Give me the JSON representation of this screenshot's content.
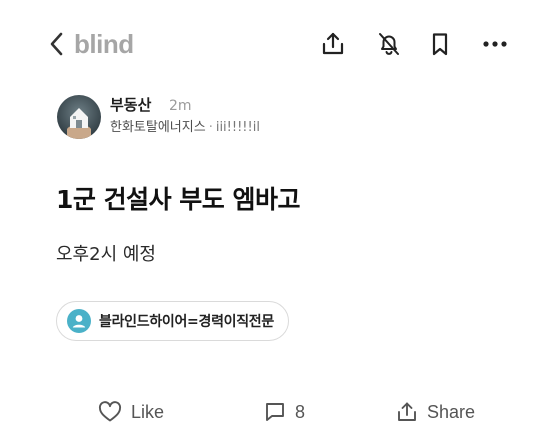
{
  "header": {
    "brand": "blind",
    "icons": [
      "chevron-left-icon",
      "share-icon",
      "bell-off-icon",
      "bookmark-icon",
      "more-icon"
    ]
  },
  "author": {
    "name": "부동산",
    "time": "2m",
    "company": "한화토탈에너지스",
    "separator": "·",
    "handle": "iii!!!!!il"
  },
  "post": {
    "title": "1군 건설사 부도 엠바고",
    "body": "오후2시 예정"
  },
  "channel": {
    "label": "블라인드하이어=경력이직전문",
    "icon": "person-icon",
    "icon_color": "#4ab1c8"
  },
  "footer": {
    "like_label": "Like",
    "comment_count": "8",
    "share_label": "Share"
  },
  "colors": {
    "brand": "#a6a6a6",
    "text": "#1c1c1c",
    "muted": "#9b9b9b"
  }
}
